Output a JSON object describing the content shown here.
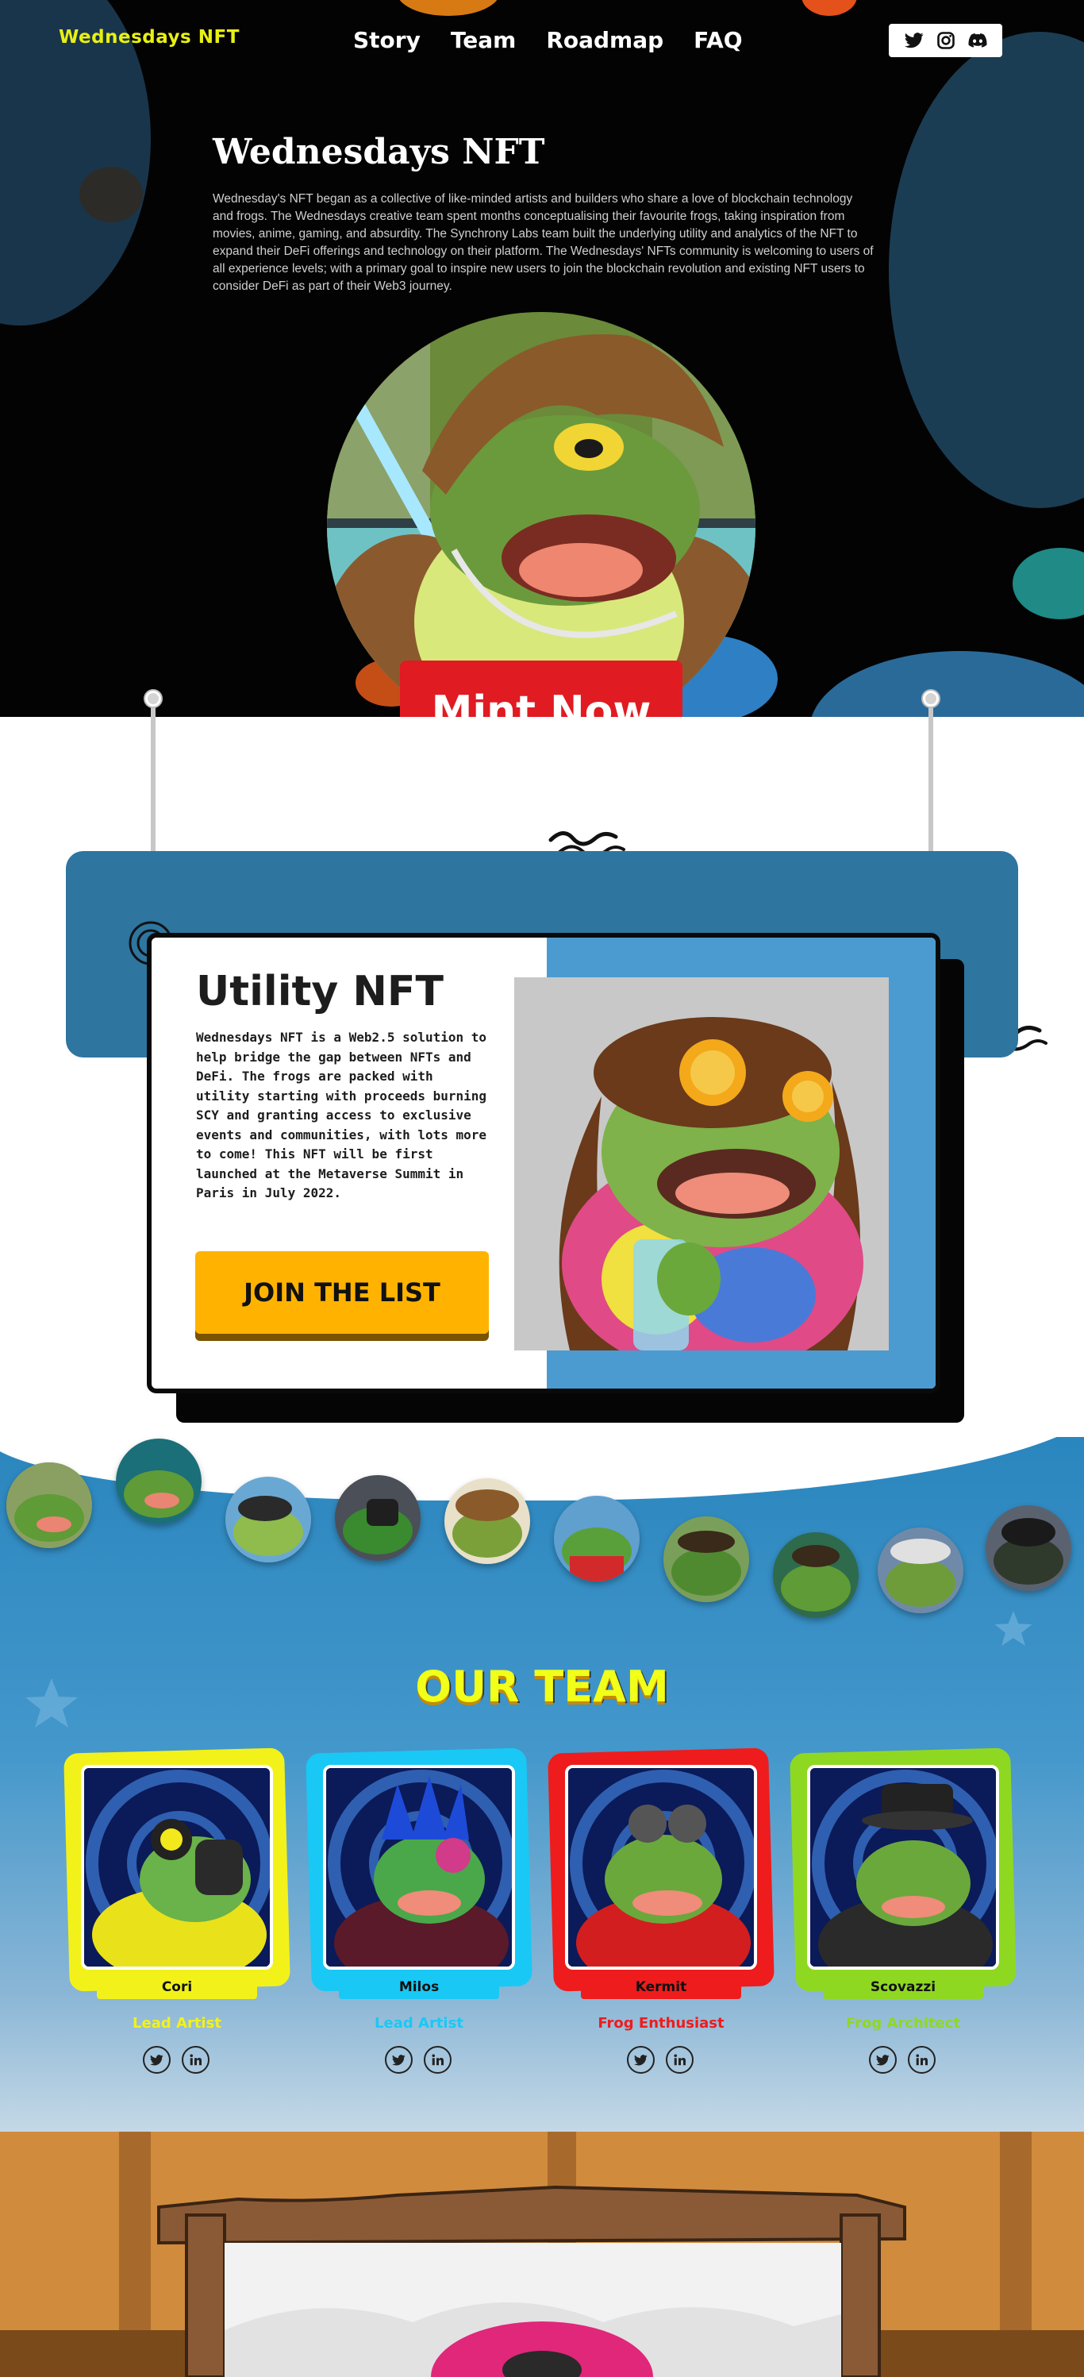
{
  "nav": {
    "logo": "Wednesdays NFT",
    "links": [
      "Story",
      "Team",
      "Roadmap",
      "FAQ"
    ],
    "social_icons": [
      "twitter-icon",
      "instagram-icon",
      "discord-icon"
    ]
  },
  "hero": {
    "title": "Wednesdays NFT",
    "description": "Wednesday's NFT began as a collective of like-minded artists and builders who share a love of blockchain technology and frogs. The Wednesdays creative team spent months conceptualising their favourite frogs, taking inspiration from movies, anime, gaming, and absurdity. The Synchrony Labs team built the underlying utility and analytics of the NFT to expand their DeFi offerings and technology on their platform. The Wednesdays' NFTs community is welcoming to users of all experience levels; with a primary goal to inspire new users to join the blockchain revolution and existing NFT users to consider DeFi as part of their Web3 journey.",
    "mint_label": "Mint Now"
  },
  "utility": {
    "title": "Utility NFT",
    "text": "Wednesdays NFT is a Web2.5 solution to help bridge the gap between NFTs and DeFi. The frogs are packed with utility starting with proceeds burning SCY and granting access to exclusive events and communities, with lots more to come! This NFT will be first launched at the Metaverse Summit in Paris in July 2022.",
    "join_label": "JOIN THE LIST"
  },
  "team": {
    "title": "OUR TEAM",
    "members": [
      {
        "name": "Cori",
        "role": "Lead Artist",
        "frame_color": "#f2f21a",
        "role_color": "#f2f21a"
      },
      {
        "name": "Milos",
        "role": "Lead Artist",
        "frame_color": "#19c8f5",
        "role_color": "#19c8f5"
      },
      {
        "name": "Kermit",
        "role": "Frog Enthusiast",
        "frame_color": "#ee1c1c",
        "role_color": "#ee1c1c"
      },
      {
        "name": "Scovazzi",
        "role": "Frog Architect",
        "frame_color": "#8fd822",
        "role_color": "#8fd822"
      }
    ]
  },
  "colors": {
    "logo_yellow": "#e8f012",
    "mint_red": "#e01b22",
    "join_yellow": "#ffb300",
    "utility_blue": "#4b9bd1",
    "team_title": "#f1ff19"
  }
}
